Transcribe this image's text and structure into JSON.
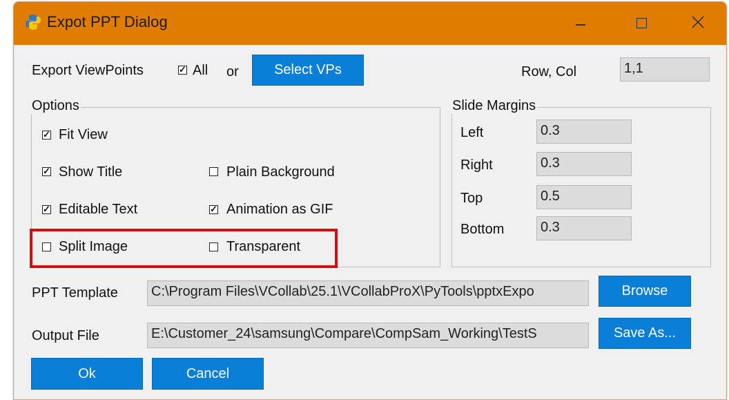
{
  "window": {
    "title": "Expot PPT Dialog",
    "controls": {
      "minimize": "—",
      "close": "✕"
    }
  },
  "top_row": {
    "export_label": "Export ViewPoints",
    "all_checked": true,
    "all_label": "All",
    "or_label": "or",
    "select_vps_label": "Select VPs",
    "row_col_label": "Row, Col",
    "row_col_value": "1,1"
  },
  "options": {
    "legend": "Options",
    "items": [
      {
        "label": "Fit View",
        "checked": true
      },
      {
        "label": "Show Title",
        "checked": true
      },
      {
        "label": "Plain Background",
        "checked": false
      },
      {
        "label": "Editable Text",
        "checked": true
      },
      {
        "label": "Animation as GIF",
        "checked": true
      },
      {
        "label": "Split Image",
        "checked": false
      },
      {
        "label": "Transparent",
        "checked": false
      }
    ]
  },
  "margins": {
    "legend": "Slide Margins",
    "rows": [
      {
        "label": "Left",
        "value": "0.3"
      },
      {
        "label": "Right",
        "value": "0.3"
      },
      {
        "label": "Top",
        "value": "0.5"
      },
      {
        "label": "Bottom",
        "value": "0.3"
      }
    ]
  },
  "template": {
    "label": "PPT Template",
    "value": "C:\\Program Files\\VCollab\\25.1\\VCollabProX\\PyTools\\pptxExpo",
    "button": "Browse"
  },
  "output": {
    "label": "Output File",
    "value": "E:\\Customer_24\\samsung\\Compare\\CompSam_Working\\TestS",
    "button": "Save As..."
  },
  "footer": {
    "ok": "Ok",
    "cancel": "Cancel"
  },
  "colors": {
    "titlebar": "#e07c00",
    "button": "#0a7fd8",
    "highlight": "#d01010"
  }
}
